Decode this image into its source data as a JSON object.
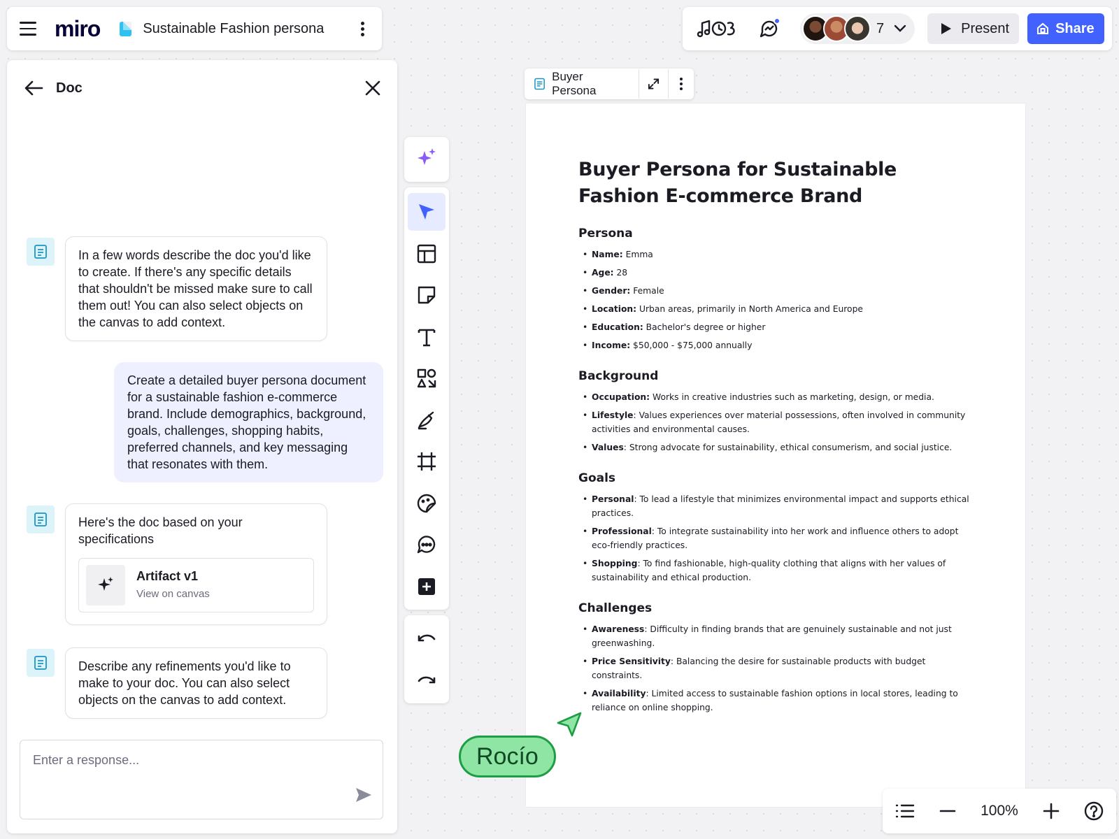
{
  "app": {
    "logo": "miro",
    "board_title": "Sustainable Fashion persona"
  },
  "topbar": {
    "collaborator_count": "7",
    "present_label": "Present",
    "share_label": "Share"
  },
  "panel": {
    "title": "Doc",
    "messages": [
      {
        "from": "assistant",
        "text": "In a few words describe the doc you'd like to create. If there's any specific details that shouldn't be missed make sure to call them out! You can also select objects on the canvas to add context."
      },
      {
        "from": "user",
        "text": "Create a detailed buyer persona document for a sustainable fashion e-commerce brand. Include demographics, background, goals, challenges, shopping habits, preferred channels, and key messaging that resonates with them."
      },
      {
        "from": "assistant",
        "text": "Here's the doc based on your specifications"
      },
      {
        "from": "assistant",
        "text": "Describe any refinements you'd like to make to your doc. You can also select objects on the canvas to add context."
      }
    ],
    "artifact": {
      "title": "Artifact v1",
      "subtitle": "View on canvas"
    },
    "input_placeholder": "Enter a response..."
  },
  "doc": {
    "frame_title": "Buyer Persona",
    "title": "Buyer Persona for Sustainable Fashion E-commerce Brand",
    "sections": [
      {
        "heading": "Persona",
        "items": [
          {
            "label": "Name:",
            "text": " Emma"
          },
          {
            "label": "Age:",
            "text": " 28"
          },
          {
            "label": "Gender:",
            "text": " Female"
          },
          {
            "label": "Location:",
            "text": " Urban areas, primarily in North America and Europe"
          },
          {
            "label": "Education:",
            "text": " Bachelor's degree or higher"
          },
          {
            "label": "Income:",
            "text": " $50,000 - $75,000 annually"
          }
        ]
      },
      {
        "heading": "Background",
        "items": [
          {
            "label": "Occupation:",
            "text": " Works in creative industries such as marketing, design, or media."
          },
          {
            "label": "Lifestyle",
            "text": ": Values experiences over material possessions, often involved in community activities and environmental causes."
          },
          {
            "label": "Values",
            "text": ": Strong advocate for sustainability, ethical consumerism, and social justice."
          }
        ]
      },
      {
        "heading": "Goals",
        "items": [
          {
            "label": "Personal",
            "text": ": To lead a lifestyle that minimizes environmental impact and supports ethical practices."
          },
          {
            "label": "Professional",
            "text": ": To integrate sustainability into her work and influence others to adopt eco-friendly practices."
          },
          {
            "label": "Shopping",
            "text": ": To find fashionable, high-quality clothing that aligns with her values of sustainability and ethical production."
          }
        ]
      },
      {
        "heading": "Challenges",
        "items": [
          {
            "label": "Awareness",
            "text": ": Difficulty in finding brands that are genuinely sustainable and not just greenwashing."
          },
          {
            "label": "Price Sensitivity",
            "text": ": Balancing the desire for sustainable products with budget constraints."
          },
          {
            "label": "Availability",
            "text": ": Limited access to sustainable fashion options in local stores, leading to reliance on online shopping."
          }
        ]
      }
    ]
  },
  "cursor": {
    "name": "Rocío",
    "color": "#8fe5a3"
  },
  "zoom": {
    "level": "100%"
  },
  "colors": {
    "accent": "#4262ff",
    "tool_active": "#e6ebff",
    "ai_purple": "#8a5cf6"
  }
}
